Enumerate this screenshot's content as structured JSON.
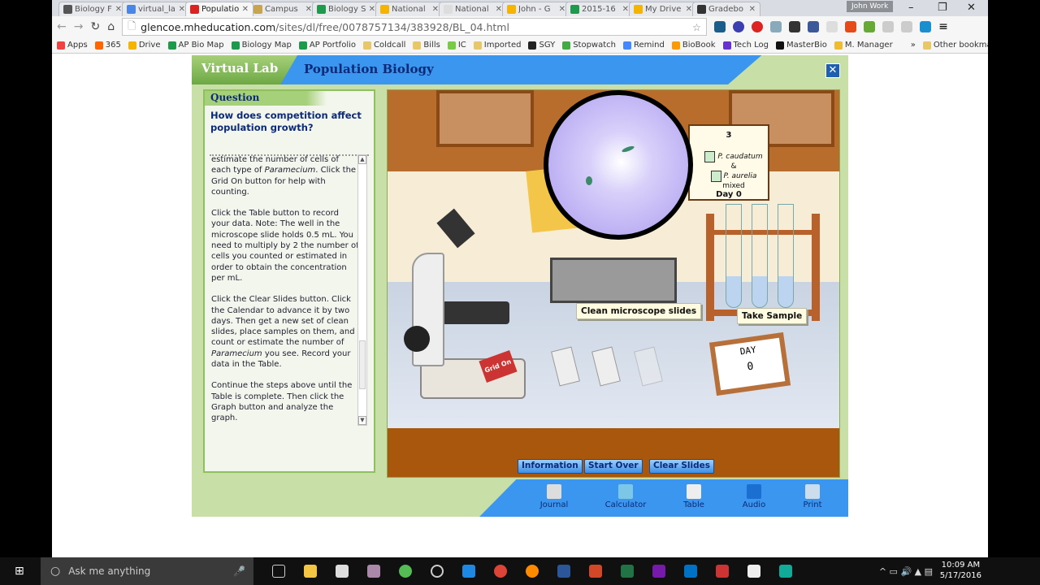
{
  "browser": {
    "tabs": [
      {
        "title": "Biology F",
        "color": "#555"
      },
      {
        "title": "virtual_la",
        "color": "#4a86e8"
      },
      {
        "title": "Populatio",
        "color": "#d22",
        "active": true
      },
      {
        "title": "Campus",
        "color": "#c9a450"
      },
      {
        "title": "Biology S",
        "color": "#1e9a4c"
      },
      {
        "title": "National",
        "color": "#f4b400"
      },
      {
        "title": "National",
        "color": "#ddd"
      },
      {
        "title": "John - G",
        "color": "#f4b400"
      },
      {
        "title": "2015-16",
        "color": "#1e9a4c"
      },
      {
        "title": "My Drive",
        "color": "#f4b400"
      },
      {
        "title": "Gradebo",
        "color": "#333"
      }
    ],
    "profile": "John Work",
    "url_host": "glencoe.mheducation.com",
    "url_path": "/sites/dl/free/0078757134/383928/BL_04.html",
    "bookmarks": [
      {
        "label": "Apps",
        "color": "#e44"
      },
      {
        "label": "365",
        "color": "#f60"
      },
      {
        "label": "Drive",
        "color": "#f4b400"
      },
      {
        "label": "AP Bio Map",
        "color": "#1e9a4c"
      },
      {
        "label": "Biology Map",
        "color": "#1e9a4c"
      },
      {
        "label": "AP Portfolio",
        "color": "#1e9a4c"
      },
      {
        "label": "Coldcall",
        "color": "#e8c66a"
      },
      {
        "label": "Bills",
        "color": "#e8c66a"
      },
      {
        "label": "IC",
        "color": "#7c4"
      },
      {
        "label": "Imported",
        "color": "#e8c66a"
      },
      {
        "label": "SGY",
        "color": "#222"
      },
      {
        "label": "Stopwatch",
        "color": "#4a4"
      },
      {
        "label": "Remind",
        "color": "#48f"
      },
      {
        "label": "BioBook",
        "color": "#f90"
      },
      {
        "label": "Tech Log",
        "color": "#63c"
      },
      {
        "label": "MasterBio",
        "color": "#111"
      },
      {
        "label": "M. Manager",
        "color": "#eb3"
      },
      {
        "label": "»",
        "color": "transparent"
      },
      {
        "label": "Other bookmarks",
        "color": "#e8c66a"
      }
    ]
  },
  "lab": {
    "brand": "Virtual Lab",
    "title": "Population Biology",
    "close": "✕",
    "question_label": "Question",
    "question": "How does competition affect population growth?",
    "instructions": [
      "estimate the number of cells of each type of Paramecium. Click the Grid On button for help with counting.",
      "Click the Table button to record your data. Note: The well in the microscope slide holds 0.5 mL. You need to multiply by 2 the number of cells you counted or estimated in order to obtain the concentration per mL.",
      "Click the Clear Slides button. Click the Calendar to advance it by two days. Then get a new set of clean slides, place samples on them, and count or estimate the number of Paramecium you see. Record your data in the Table.",
      "Continue the steps above until the Table is complete. Then click the Graph button and analyze the graph."
    ],
    "legend": {
      "number": "3",
      "species1": "P. caudatum",
      "amp": "&",
      "species2": "P. aurelia",
      "mixed": "mixed",
      "day": "Day 0"
    },
    "clean_slides": "Clean microscope slides",
    "take_sample": "Take Sample",
    "calendar": {
      "label": "DAY",
      "value": "0"
    },
    "grid_button": "Grid On",
    "buttons": {
      "information": "Information",
      "start_over": "Start Over",
      "clear_slides": "Clear Slides"
    },
    "tools": [
      {
        "label": "Journal",
        "color": "#ddd"
      },
      {
        "label": "Calculator",
        "color": "#7cc7e8"
      },
      {
        "label": "Table",
        "color": "#eee"
      },
      {
        "label": "Audio",
        "color": "#1a6fd0"
      },
      {
        "label": "Print",
        "color": "#cde"
      }
    ]
  },
  "taskbar": {
    "search_placeholder": "Ask me anything",
    "time": "10:09 AM",
    "date": "5/17/2016"
  }
}
